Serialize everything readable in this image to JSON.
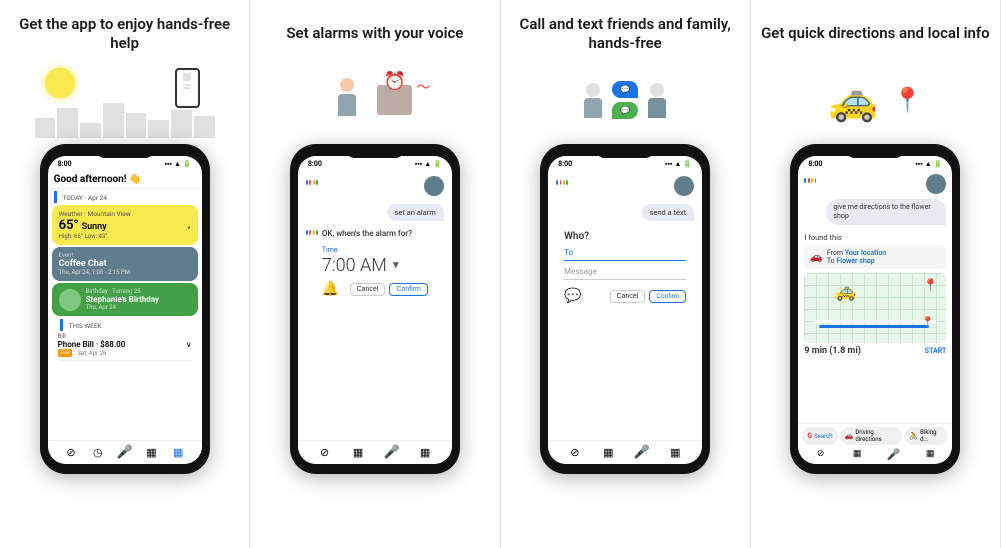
{
  "panels": [
    {
      "id": "panel1",
      "title": "Get the app to enjoy hands-free help",
      "phone": {
        "time": "8:00",
        "greeting": "Good afternoon! 👋",
        "today_label": "TODAY · Apr 24",
        "weather": {
          "label": "Weather · Mountain View",
          "temp": "65°",
          "condition": "Sunny",
          "high_low": "High: 66° Low: 43°"
        },
        "event": {
          "label": "Event",
          "title": "Coffee Chat",
          "time": "Thu, Apr 24, 1:00 - 2:15 PM"
        },
        "birthday": {
          "label": "Birthday · Turning 25",
          "name": "Stephanie's Birthday",
          "date": "Thu, Apr 24"
        },
        "bill_section": "THIS WEEK",
        "bill": {
          "name": "Phone Bill · $88.00",
          "date": "Sat, Apr 26",
          "badge": "Due"
        }
      }
    },
    {
      "id": "panel2",
      "title": "Set alarms with your voice",
      "phone": {
        "time": "8:00",
        "user_bubble": "set an alarm",
        "assistant_question": "OK, when's the alarm for?",
        "time_label": "Time",
        "time_value": "7:00 AM",
        "cancel_btn": "Cancel",
        "confirm_btn": "Confirm"
      }
    },
    {
      "id": "panel3",
      "title": "Call and text friends and family, hands-free",
      "phone": {
        "time": "8:00",
        "user_bubble": "send a text",
        "who_label": "Who?",
        "to_placeholder": "To",
        "message_placeholder": "Message",
        "cancel_btn": "Cancel",
        "confirm_btn": "Confirm"
      }
    },
    {
      "id": "panel4",
      "title": "Get quick directions and local info",
      "phone": {
        "time": "8:00",
        "user_bubble": "give me directions to the flower shop",
        "found_text": "I found this",
        "from": "Your location",
        "to": "Flower shop",
        "eta": "9 min (1.8 mi)",
        "start_btn": "START",
        "tabs": [
          "Search",
          "Driving directions",
          "Biking d..."
        ]
      }
    }
  ],
  "nav": {
    "items": [
      "compass",
      "clock",
      "mic",
      "keyboard",
      "calendar"
    ]
  }
}
